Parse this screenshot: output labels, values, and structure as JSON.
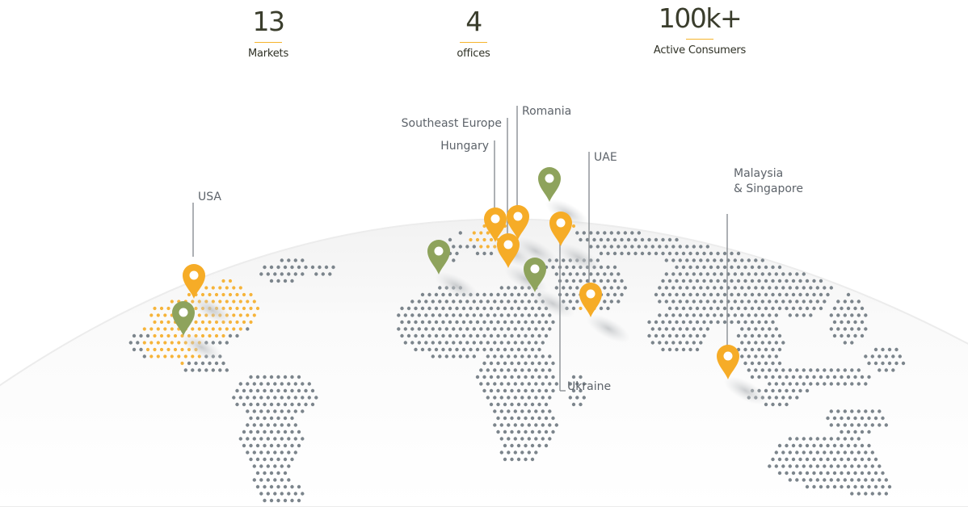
{
  "stats": [
    {
      "value": "13",
      "label": "Markets"
    },
    {
      "value": "4",
      "label": "offices"
    },
    {
      "value": "100k+",
      "label": "Active Consumers"
    }
  ],
  "regions": {
    "usa": "USA",
    "southeast_europe": "Southeast Europe",
    "romania": "Romania",
    "hungary": "Hungary",
    "uae": "UAE",
    "ukraine": "Ukraine",
    "malaysia_line1": "Malaysia",
    "malaysia_line2": "& Singapore"
  },
  "colors": {
    "market_pin": "#f6ac27",
    "office_pin": "#8ea35c",
    "dot_land": "#7c858c",
    "dot_market": "#f6b43a",
    "stat_underline": "#f6b42c",
    "stat_text": "#3a3d2c"
  },
  "icons": {
    "market_pin": "map-pin-icon",
    "office_pin": "map-pin-icon"
  }
}
